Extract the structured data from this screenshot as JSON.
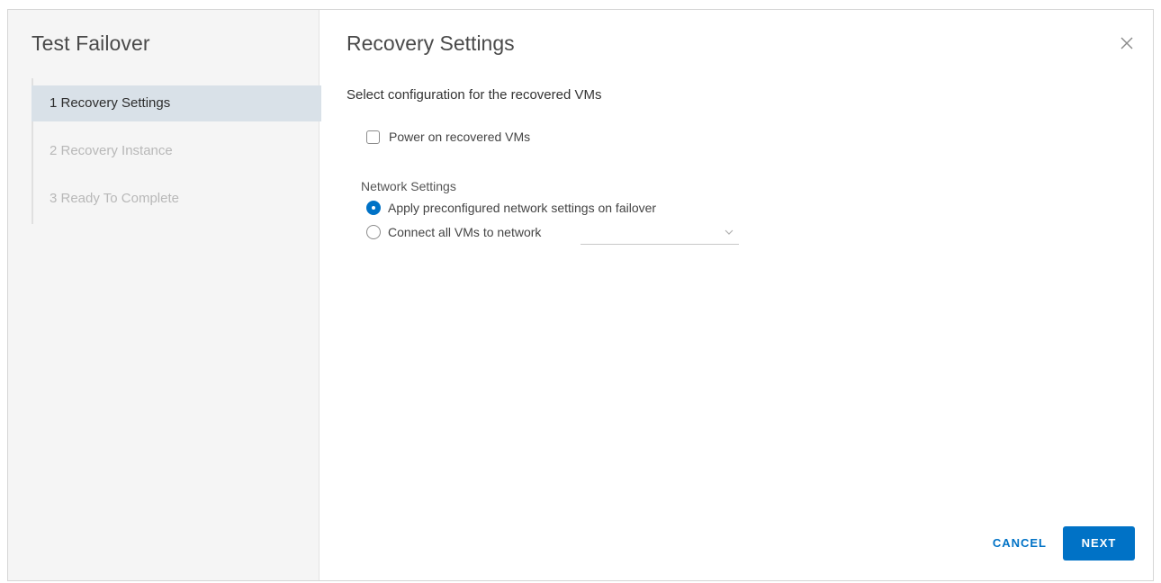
{
  "wizard": {
    "title": "Test Failover",
    "steps": [
      {
        "label": "1 Recovery Settings",
        "state": "active"
      },
      {
        "label": "2 Recovery Instance",
        "state": "inactive"
      },
      {
        "label": "3 Ready To Complete",
        "state": "inactive"
      }
    ]
  },
  "page": {
    "title": "Recovery Settings",
    "heading": "Select configuration for the recovered VMs",
    "power_on": {
      "label": "Power on recovered VMs",
      "checked": false
    },
    "network": {
      "label": "Network Settings",
      "options": [
        {
          "label": "Apply preconfigured network settings on failover",
          "selected": true
        },
        {
          "label": "Connect all VMs to network",
          "selected": false
        }
      ],
      "select_value": ""
    }
  },
  "footer": {
    "cancel_label": "CANCEL",
    "next_label": "NEXT"
  },
  "colors": {
    "accent": "#0072c6",
    "active_step_bg": "#d9e1e8"
  },
  "icons": [
    "close-icon",
    "chevron-down-icon"
  ]
}
